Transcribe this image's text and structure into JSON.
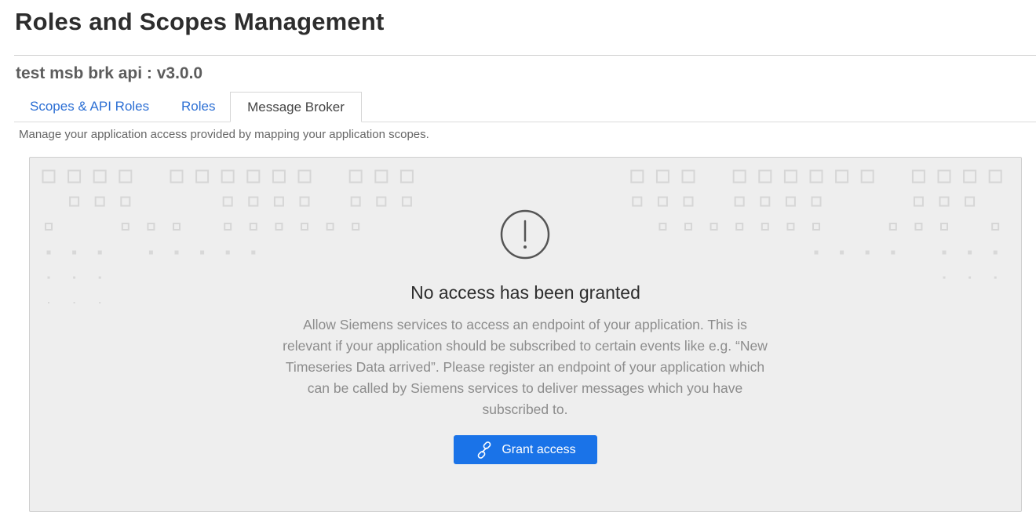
{
  "header": {
    "title": "Roles and Scopes Management"
  },
  "app": {
    "name": "test msb brk api : v3.0.0"
  },
  "tabs": [
    {
      "label": "Scopes & API Roles",
      "active": false
    },
    {
      "label": "Roles",
      "active": false
    },
    {
      "label": "Message Broker",
      "active": true
    }
  ],
  "description": "Manage your application access provided by mapping your application scopes.",
  "empty_state": {
    "icon": "exclamation-circle-icon",
    "title": "No access has been granted",
    "body": "Allow Siemens services to access an endpoint of your application. This is relevant if your application should be subscribed to certain events like e.g. “New Timeseries Data arrived”. Please register an endpoint of your application which can be called by Siemens services to deliver messages which you have subscribed to.",
    "button_label": "Grant access",
    "button_icon": "link-icon"
  },
  "colors": {
    "accent": "#1a73e8",
    "tab_link": "#2c6fd4",
    "panel_bg": "#eeeeee"
  }
}
